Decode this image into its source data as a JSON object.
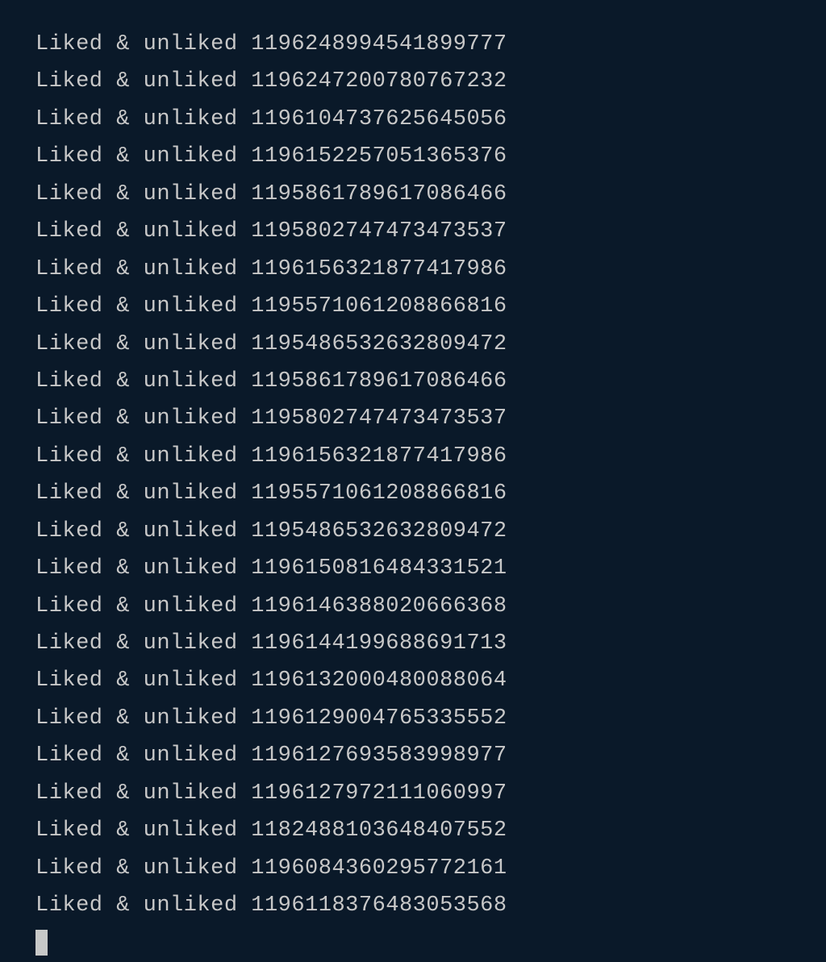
{
  "terminal": {
    "prefix": "Liked & unliked ",
    "ids": [
      "1196248994541899777",
      "1196247200780767232",
      "1196104737625645056",
      "1196152257051365376",
      "1195861789617086466",
      "1195802747473473537",
      "1196156321877417986",
      "1195571061208866816",
      "1195486532632809472",
      "1195861789617086466",
      "1195802747473473537",
      "1196156321877417986",
      "1195571061208866816",
      "1195486532632809472",
      "1196150816484331521",
      "1196146388020666368",
      "1196144199688691713",
      "1196132000480088064",
      "1196129004765335552",
      "1196127693583998977",
      "1196127972111060997",
      "1182488103648407552",
      "1196084360295772161",
      "1196118376483053568"
    ]
  }
}
